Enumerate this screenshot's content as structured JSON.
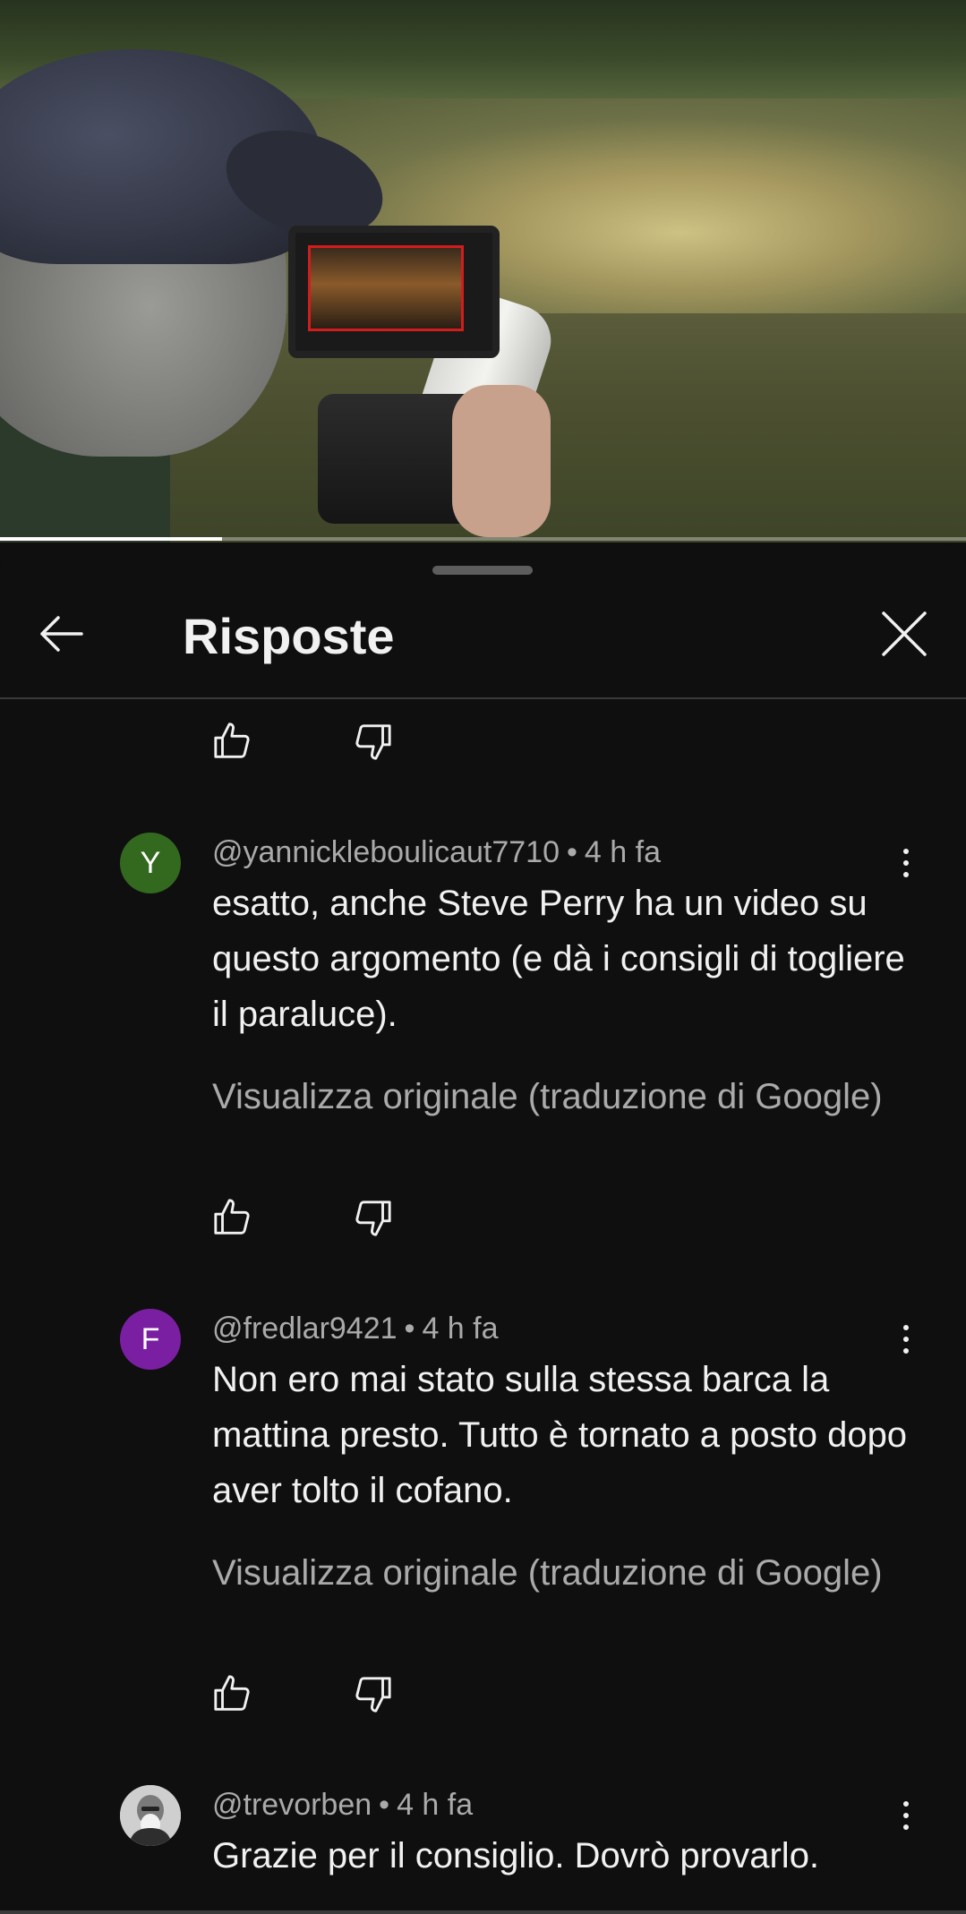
{
  "video": {
    "progress_fraction": 0.23
  },
  "header": {
    "title": "Risposte"
  },
  "comments": [
    {
      "avatar_letter": "Y",
      "avatar_color": "#33691e",
      "author": "@yannickleboulicaut7710",
      "separator": "•",
      "time": "4 h fa",
      "text": "esatto, anche Steve Perry ha un video su questo argomento (e dà i consigli di togliere il paraluce).",
      "translation_link": "Visualizza originale (traduzione di Google)"
    },
    {
      "avatar_letter": "F",
      "avatar_color": "#7b1fa2",
      "author": "@fredlar9421",
      "separator": "•",
      "time": "4 h fa",
      "text": "Non ero mai stato sulla stessa barca la mattina presto. Tutto è tornato a posto dopo aver tolto il cofano.",
      "translation_link": "Visualizza originale (traduzione di Google)"
    },
    {
      "author": "@trevorben",
      "separator": "•",
      "time": "4 h fa",
      "text": "Grazie per il consiglio. Dovrò provarlo."
    }
  ],
  "icons": {
    "back": "arrow-left-icon",
    "close": "close-icon",
    "like": "thumb-up-icon",
    "dislike": "thumb-down-icon",
    "more": "more-vertical-icon"
  }
}
